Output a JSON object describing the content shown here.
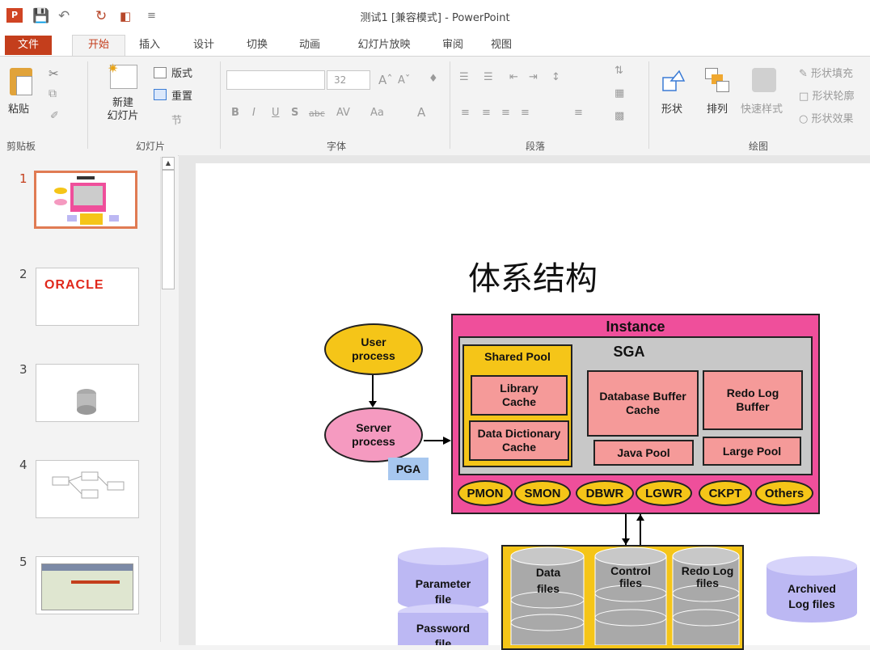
{
  "window": {
    "title": "测试1 [兼容模式] - PowerPoint"
  },
  "tabs": [
    "文件",
    "开始",
    "插入",
    "设计",
    "切换",
    "动画",
    "幻灯片放映",
    "审阅",
    "视图"
  ],
  "ribbon": {
    "clipboard": {
      "paste": "粘贴",
      "label": "剪贴板"
    },
    "slides": {
      "new_slide": "新建\n幻灯片",
      "layout": "版式",
      "reset": "重置",
      "section": "节",
      "label": "幻灯片"
    },
    "font": {
      "size": "32",
      "label": "字体"
    },
    "paragraph": {
      "label": "段落"
    },
    "drawing": {
      "shape": "形状",
      "arrange": "排列",
      "quick_styles": "快速样式",
      "shape_fill": "形状填充",
      "shape_outline": "形状轮廓",
      "shape_effects": "形状效果",
      "label": "绘图"
    }
  },
  "thumbnails": [
    {
      "num": "1",
      "selected": true
    },
    {
      "num": "2",
      "text": "ORACLE"
    },
    {
      "num": "3"
    },
    {
      "num": "4"
    },
    {
      "num": "5"
    }
  ],
  "slide": {
    "title": "体系结构",
    "user_process": "User process",
    "server_process": "Server process",
    "pga": "PGA",
    "instance": "Instance",
    "sga": "SGA",
    "shared_pool": "Shared Pool",
    "library_cache": "Library Cache",
    "data_dictionary_cache": "Data Dictionary Cache",
    "db_buffer_cache": "Database Buffer Cache",
    "redo_log_buffer": "Redo Log Buffer",
    "java_pool": "Java Pool",
    "large_pool": "Large Pool",
    "processes": [
      "PMON",
      "SMON",
      "DBWR",
      "LGWR",
      "CKPT",
      "Others"
    ],
    "data_files": "Data files",
    "control_files": "Control files",
    "redo_log_files": "Redo Log files",
    "parameter_file": "Parameter file",
    "password_file": "Password file",
    "archived_log_files": "Archived Log files"
  },
  "colors": {
    "accent": "#c43e1c",
    "instance_pink": "#ef4f9b",
    "sga_gray": "#c8c8c8",
    "pool_salmon": "#f59a99",
    "process_yellow": "#f5c518",
    "pga_blue": "#a7c7ef",
    "db_yellow": "#f5c518",
    "lilac": "#bcb8f3"
  }
}
